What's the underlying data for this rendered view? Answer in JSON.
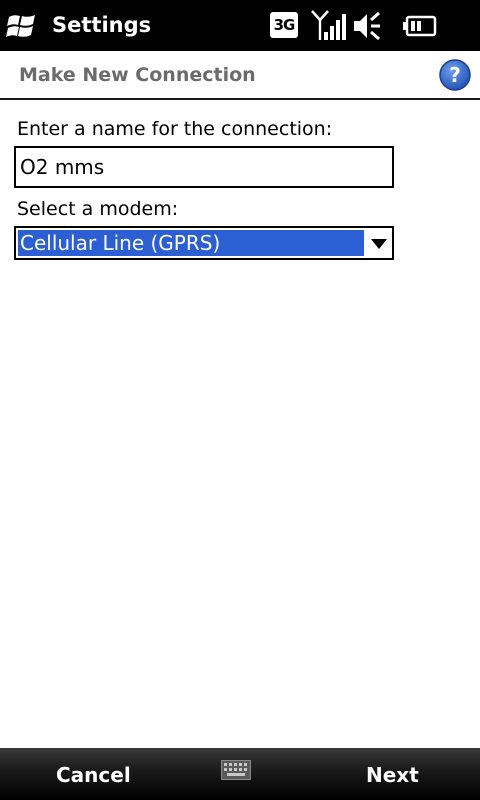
{
  "status_bar": {
    "app_title": "Settings",
    "network_type": "3G",
    "icons": [
      "windows-start-icon",
      "signal-strength-icon",
      "volume-muted-icon",
      "battery-icon"
    ]
  },
  "header": {
    "title": "Make New Connection",
    "help_icon": "help-icon"
  },
  "form": {
    "name_label": "Enter a name for the connection:",
    "name_value": "O2 mms",
    "modem_label": "Select a modem:",
    "modem_value": "Cellular Line (GPRS)"
  },
  "softkeys": {
    "left_label": "Cancel",
    "right_label": "Next",
    "center_icon": "keyboard-icon"
  },
  "colors": {
    "bar_background": "#000000",
    "selection": "#2b5fd3",
    "title_gray": "#6b6b6b",
    "help_blue": "#2a5fc8"
  }
}
